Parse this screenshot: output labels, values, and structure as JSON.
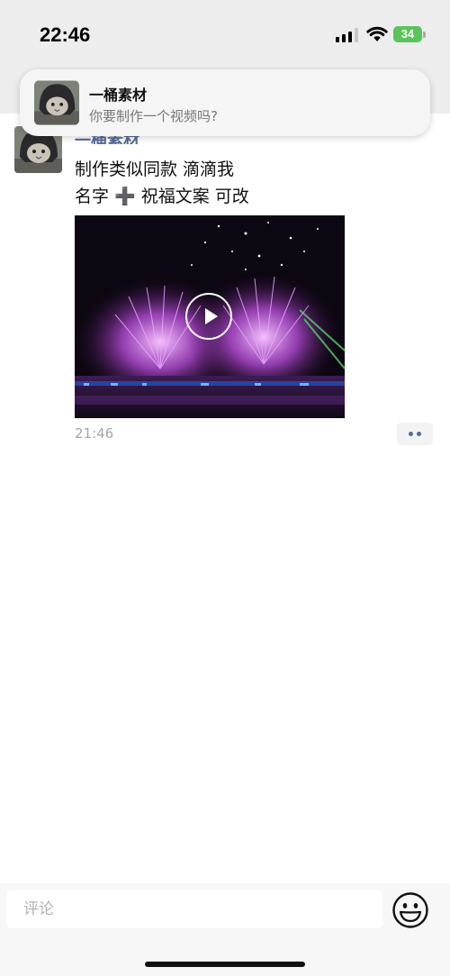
{
  "status_bar": {
    "time": "22:46",
    "battery_level": "34",
    "icons": [
      "cellular-signal-icon",
      "wifi-icon",
      "battery-charging-icon"
    ],
    "battery_color": "#5bc35b"
  },
  "notification": {
    "title": "一桶素材",
    "body": "你要制作一个视频吗?",
    "avatar_icon": "cat-helmet-avatar"
  },
  "post": {
    "author": "一桶素材",
    "text_line1": "制作类似同款 滴滴我",
    "text_line2": "名字 ➕ 祝福文案 可改",
    "video": {
      "description_icon": "fireworks-video-thumbnail",
      "play_icon": "play-icon"
    },
    "time": "21:46",
    "more_icon": "more-dots-icon",
    "author_color": "#576b95"
  },
  "comment_bar": {
    "placeholder": "评论",
    "emoji_icon": "smiley-emoji-icon"
  }
}
